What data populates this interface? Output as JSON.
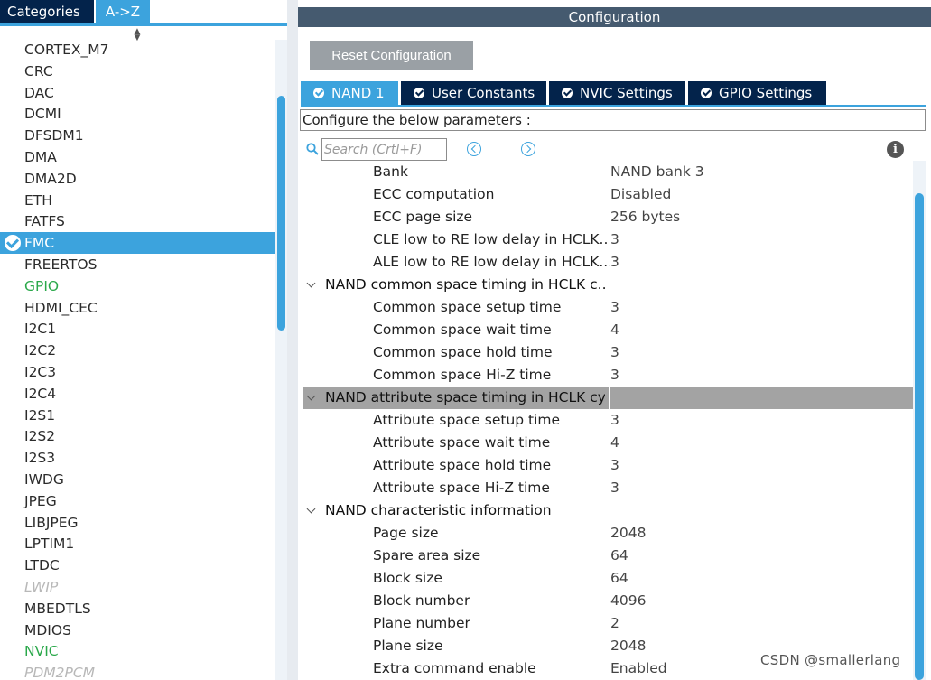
{
  "left_panel": {
    "tabs": {
      "categories": "Categories",
      "a_to_z": "A->Z"
    },
    "items": [
      {
        "label": "CORTEX_M7",
        "state": "normal"
      },
      {
        "label": "CRC",
        "state": "normal"
      },
      {
        "label": "DAC",
        "state": "normal"
      },
      {
        "label": "DCMI",
        "state": "normal"
      },
      {
        "label": "DFSDM1",
        "state": "normal"
      },
      {
        "label": "DMA",
        "state": "normal"
      },
      {
        "label": "DMA2D",
        "state": "normal"
      },
      {
        "label": "ETH",
        "state": "normal"
      },
      {
        "label": "FATFS",
        "state": "normal"
      },
      {
        "label": "FMC",
        "state": "selected"
      },
      {
        "label": "FREERTOS",
        "state": "normal"
      },
      {
        "label": "GPIO",
        "state": "green"
      },
      {
        "label": "HDMI_CEC",
        "state": "normal"
      },
      {
        "label": "I2C1",
        "state": "normal"
      },
      {
        "label": "I2C2",
        "state": "normal"
      },
      {
        "label": "I2C3",
        "state": "normal"
      },
      {
        "label": "I2C4",
        "state": "normal"
      },
      {
        "label": "I2S1",
        "state": "normal"
      },
      {
        "label": "I2S2",
        "state": "normal"
      },
      {
        "label": "I2S3",
        "state": "normal"
      },
      {
        "label": "IWDG",
        "state": "normal"
      },
      {
        "label": "JPEG",
        "state": "normal"
      },
      {
        "label": "LIBJPEG",
        "state": "normal"
      },
      {
        "label": "LPTIM1",
        "state": "normal"
      },
      {
        "label": "LTDC",
        "state": "normal"
      },
      {
        "label": "LWIP",
        "state": "disabled"
      },
      {
        "label": "MBEDTLS",
        "state": "normal"
      },
      {
        "label": "MDIOS",
        "state": "normal"
      },
      {
        "label": "NVIC",
        "state": "green"
      },
      {
        "label": "PDM2PCM",
        "state": "disabled"
      }
    ]
  },
  "config": {
    "header": "Configuration",
    "reset_label": "Reset Configuration",
    "tabs": [
      {
        "label": "NAND 1",
        "active": true
      },
      {
        "label": "User Constants",
        "active": false
      },
      {
        "label": "NVIC Settings",
        "active": false
      },
      {
        "label": "GPIO Settings",
        "active": false
      }
    ],
    "params_label": "Configure the below parameters :",
    "search_placeholder": "Search (Crtl+F)",
    "rows": [
      {
        "type": "param",
        "name": "Bank",
        "value": "NAND bank 3"
      },
      {
        "type": "param",
        "name": "ECC computation",
        "value": "Disabled"
      },
      {
        "type": "param",
        "name": "ECC page size",
        "value": "256 bytes"
      },
      {
        "type": "param",
        "name": "CLE low to RE low delay in HCLK...",
        "value": "3"
      },
      {
        "type": "param",
        "name": "ALE low to RE low delay in HCLK...",
        "value": "3"
      },
      {
        "type": "group",
        "name": "NAND common space timing in HCLK c...",
        "value": ""
      },
      {
        "type": "param",
        "name": "Common space setup time",
        "value": "3"
      },
      {
        "type": "param",
        "name": "Common space wait time",
        "value": "4"
      },
      {
        "type": "param",
        "name": "Common space hold time",
        "value": "3"
      },
      {
        "type": "param",
        "name": "Common space Hi-Z time",
        "value": "3"
      },
      {
        "type": "group",
        "name": "NAND attribute space timing in HCLK cy...",
        "value": "",
        "highlighted": true
      },
      {
        "type": "param",
        "name": "Attribute space setup time",
        "value": "3"
      },
      {
        "type": "param",
        "name": "Attribute space wait time",
        "value": "4"
      },
      {
        "type": "param",
        "name": "Attribute space hold time",
        "value": "3"
      },
      {
        "type": "param",
        "name": "Attribute space Hi-Z time",
        "value": "3"
      },
      {
        "type": "group",
        "name": "NAND characteristic information",
        "value": ""
      },
      {
        "type": "param",
        "name": "Page size",
        "value": "2048"
      },
      {
        "type": "param",
        "name": "Spare area size",
        "value": "64"
      },
      {
        "type": "param",
        "name": "Block size",
        "value": "64"
      },
      {
        "type": "param",
        "name": "Block number",
        "value": "4096"
      },
      {
        "type": "param",
        "name": "Plane number",
        "value": "2"
      },
      {
        "type": "param",
        "name": "Plane size",
        "value": "2048"
      },
      {
        "type": "param",
        "name": "Extra command enable",
        "value": "Enabled"
      }
    ]
  },
  "watermark": "CSDN @smallerlang",
  "colors": {
    "accent": "#3ca3dd",
    "navy": "#03234b",
    "header": "#455a6f",
    "green": "#2aa84a",
    "highlight_row": "#a3a3a3"
  }
}
